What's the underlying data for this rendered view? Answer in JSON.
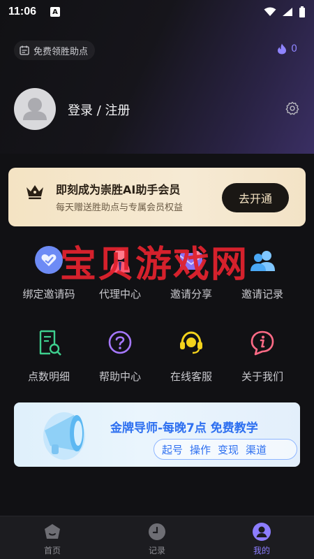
{
  "status_bar": {
    "time": "11:06",
    "badge": "A"
  },
  "header": {
    "free_points_label": "免费领胜助点",
    "points_count": "0",
    "login_label": "登录 / 注册"
  },
  "member": {
    "title": "即刻成为崇胜AI助手会员",
    "subtitle": "每天赠送胜助点与专属会员权益",
    "button_label": "去开通"
  },
  "watermark": "宝贝游戏网",
  "menu": [
    {
      "label": "绑定邀请码",
      "icon": "bind-heart-icon"
    },
    {
      "label": "代理中心",
      "icon": "agent-icon"
    },
    {
      "label": "邀请分享",
      "icon": "share-mail-icon"
    },
    {
      "label": "邀请记录",
      "icon": "people-icon"
    },
    {
      "label": "点数明细",
      "icon": "receipt-search-icon"
    },
    {
      "label": "帮助中心",
      "icon": "question-icon"
    },
    {
      "label": "在线客服",
      "icon": "headset-icon"
    },
    {
      "label": "关于我们",
      "icon": "info-icon"
    }
  ],
  "banner": {
    "title": "金牌导师-每晚7点 免费教学",
    "tags": [
      "起号",
      "操作",
      "变现",
      "渠道"
    ]
  },
  "tabbar": {
    "items": [
      {
        "label": "首页",
        "active": false
      },
      {
        "label": "记录",
        "active": false
      },
      {
        "label": "我的",
        "active": true
      }
    ]
  },
  "colors": {
    "accent": "#8c7dff",
    "member_gold": "#f4e3c3",
    "banner_blue": "#2d6ff0",
    "watermark_red": "#e0222e"
  }
}
